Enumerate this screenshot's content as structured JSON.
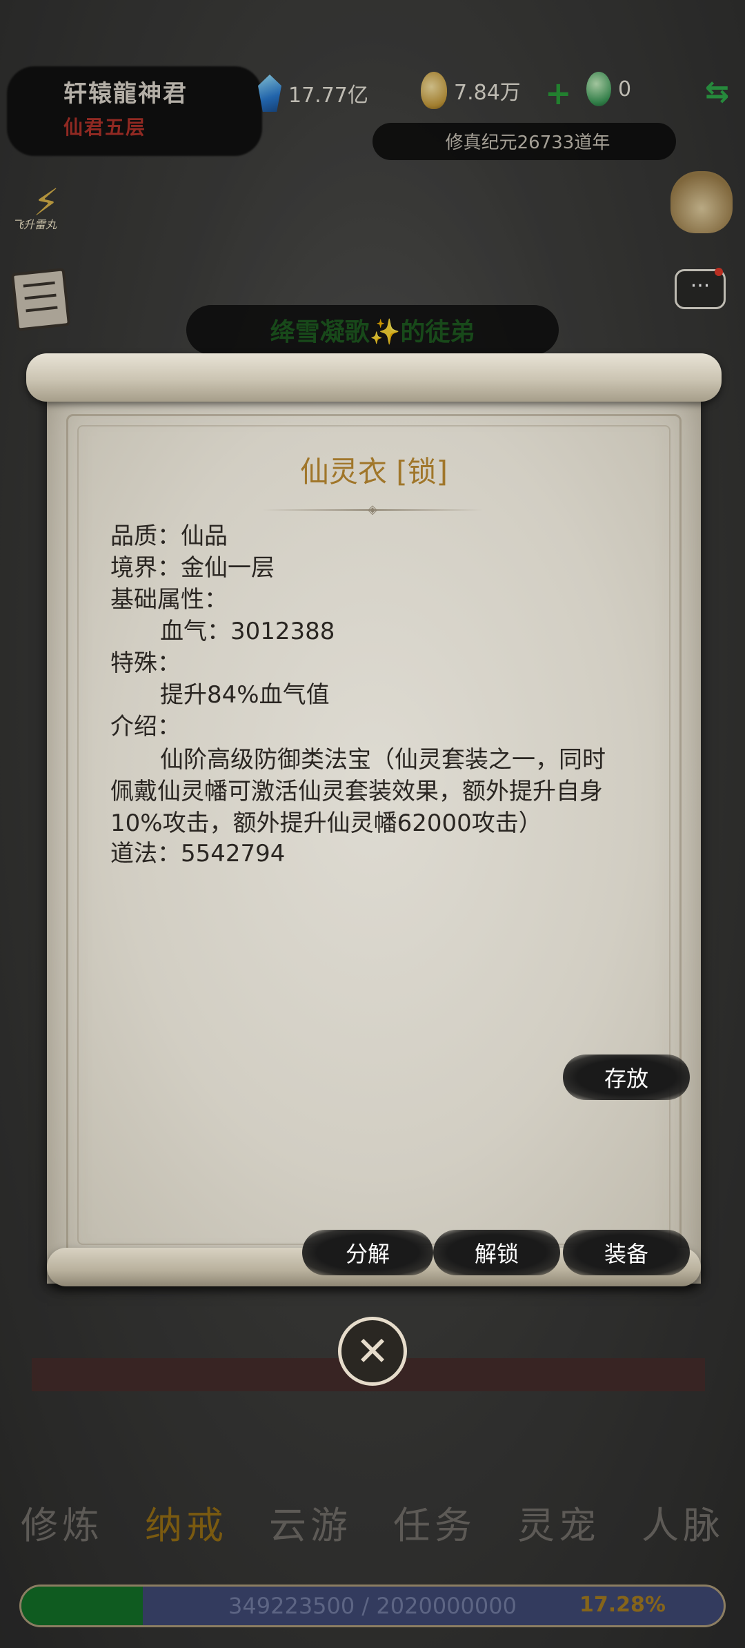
{
  "header": {
    "player_name": "轩辕龍神君",
    "realm": "仙君五层",
    "spirit_stones": "17.77亿",
    "gold": "7.84万",
    "jade": "0",
    "era": "修真纪元26733道年"
  },
  "side": {
    "bolt_label": "飞升雷丸"
  },
  "disciple_banner": "绛雪凝歌✨的徒弟",
  "item": {
    "title": "仙灵衣 [锁]",
    "quality": "品质：仙品",
    "realm": "境界：金仙一层",
    "base_attr_label": "基础属性：",
    "base_attr_value": "血气：3012388",
    "special_label": "特殊：",
    "special_value": "提升84%血气值",
    "intro_label": "介绍：",
    "intro_text": "仙阶高级防御类法宝（仙灵套装之一，同时佩戴仙灵幡可激活仙灵套装效果，额外提升自身10%攻击，额外提升仙灵幡62000攻击）",
    "dao": "道法：5542794"
  },
  "buttons": {
    "store": "存放",
    "decompose": "分解",
    "unlock": "解锁",
    "equip": "装备"
  },
  "nav": [
    "修炼",
    "纳戒",
    "云游",
    "任务",
    "灵宠",
    "人脉"
  ],
  "nav_active": 1,
  "xp": {
    "text": "349223500 / 2020000000",
    "percent_text": "17.28%",
    "fraction": 0.1728
  },
  "colors": {
    "title_gold": "#a0762a",
    "realm_red": "#b0322a",
    "xp_fill": "#0f5b20"
  }
}
